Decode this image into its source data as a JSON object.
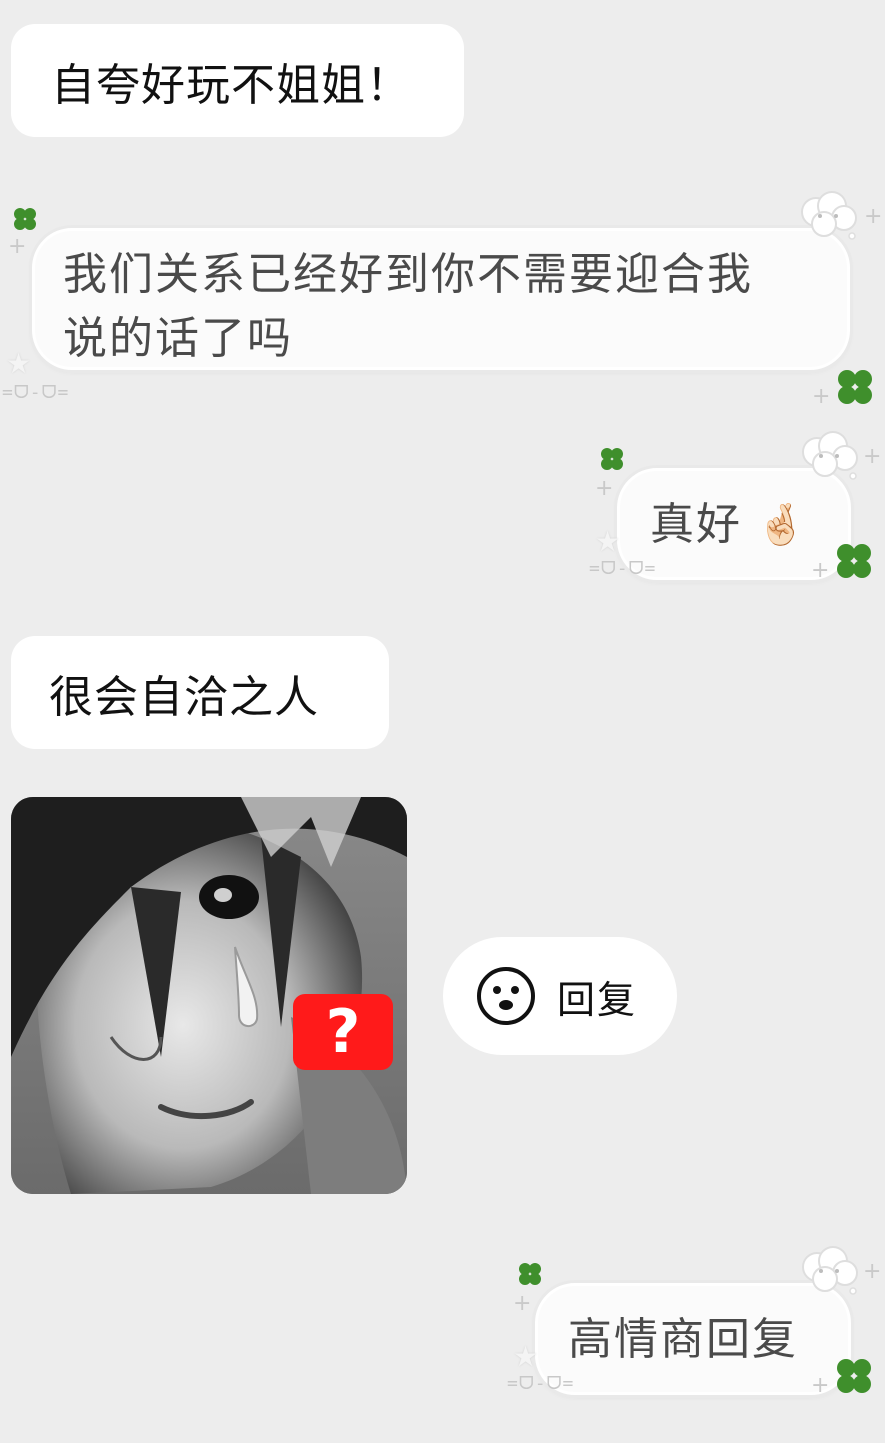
{
  "messages": {
    "m1": {
      "text": "自夸好玩不姐姐！"
    },
    "m2": {
      "line1": "我们关系已经好到你不需要迎合我",
      "line2": "说的话了吗"
    },
    "m3": {
      "text": "真好",
      "emoji": "🤞🏻"
    },
    "m4": {
      "text": "很会自洽之人"
    },
    "m5": {
      "type": "image",
      "badge": "?"
    },
    "m6": {
      "text": "高情商回复"
    }
  },
  "reply_button": {
    "label": "回复",
    "icon": "smiley-face-icon"
  },
  "decorations": {
    "face_text": "=ᗜ-ᗜ="
  },
  "colors": {
    "background": "#ededed",
    "bubble": "#ffffff",
    "clover": "#3f8f2c",
    "badge": "#ff1a1a"
  }
}
